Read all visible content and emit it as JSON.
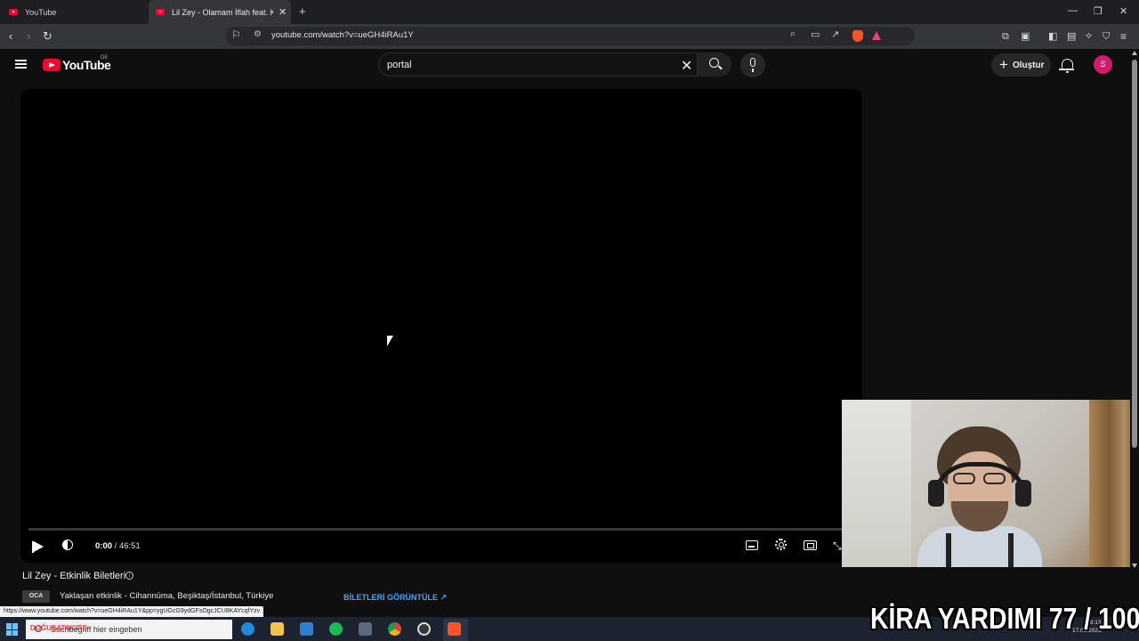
{
  "browser": {
    "tabs": [
      {
        "title": "YouTube",
        "active": false
      },
      {
        "title": "Lil Zey - Olamam İflah feat. Khontkar",
        "active": true
      }
    ],
    "new_tab_symbol": "+",
    "tab_close_symbol": "✕",
    "window_controls": {
      "minimize": "—",
      "restore": "❐",
      "close": "✕"
    },
    "url": "youtube.com/watch?v=ueGH4iRAu1Y",
    "accent_color": "#ff0033"
  },
  "youtube": {
    "logo_text": "YouTube",
    "country_code": "DE",
    "search": {
      "query": "portal"
    },
    "create_label": "Oluştur",
    "avatar_letter": "S",
    "avatar_color": "#d11b6b"
  },
  "player": {
    "current_time": "0:00",
    "duration": "46:51",
    "progress_fraction": 0.0
  },
  "below_video": {
    "event_title": "Lil Zey - Etkinlik Biletleri",
    "info_symbol": "i",
    "month_badge": "OCA",
    "event_location": "Yaklaşan etkinlik - Cihannüma, Beşiktaş/İstanbul, Türkiye",
    "tickets_label": "BİLETLERİ GÖRÜNTÜLE ↗"
  },
  "status_bar": {
    "link_url": "https://www.youtube.com/watch?v=ueGH4iRAu1Y&pp=ygUGcG9ydGFsOgcJCU8KAYcqfYzv"
  },
  "taskbar": {
    "search_placeholder": "Suchbegriff hier eingeben",
    "overlay_name": "DOĞUŞATAKIRS",
    "clock_time": "19:13",
    "clock_date": "17.01.2026"
  },
  "stream_overlay": {
    "text": "KİRA YARDIMI 77 / 100"
  }
}
